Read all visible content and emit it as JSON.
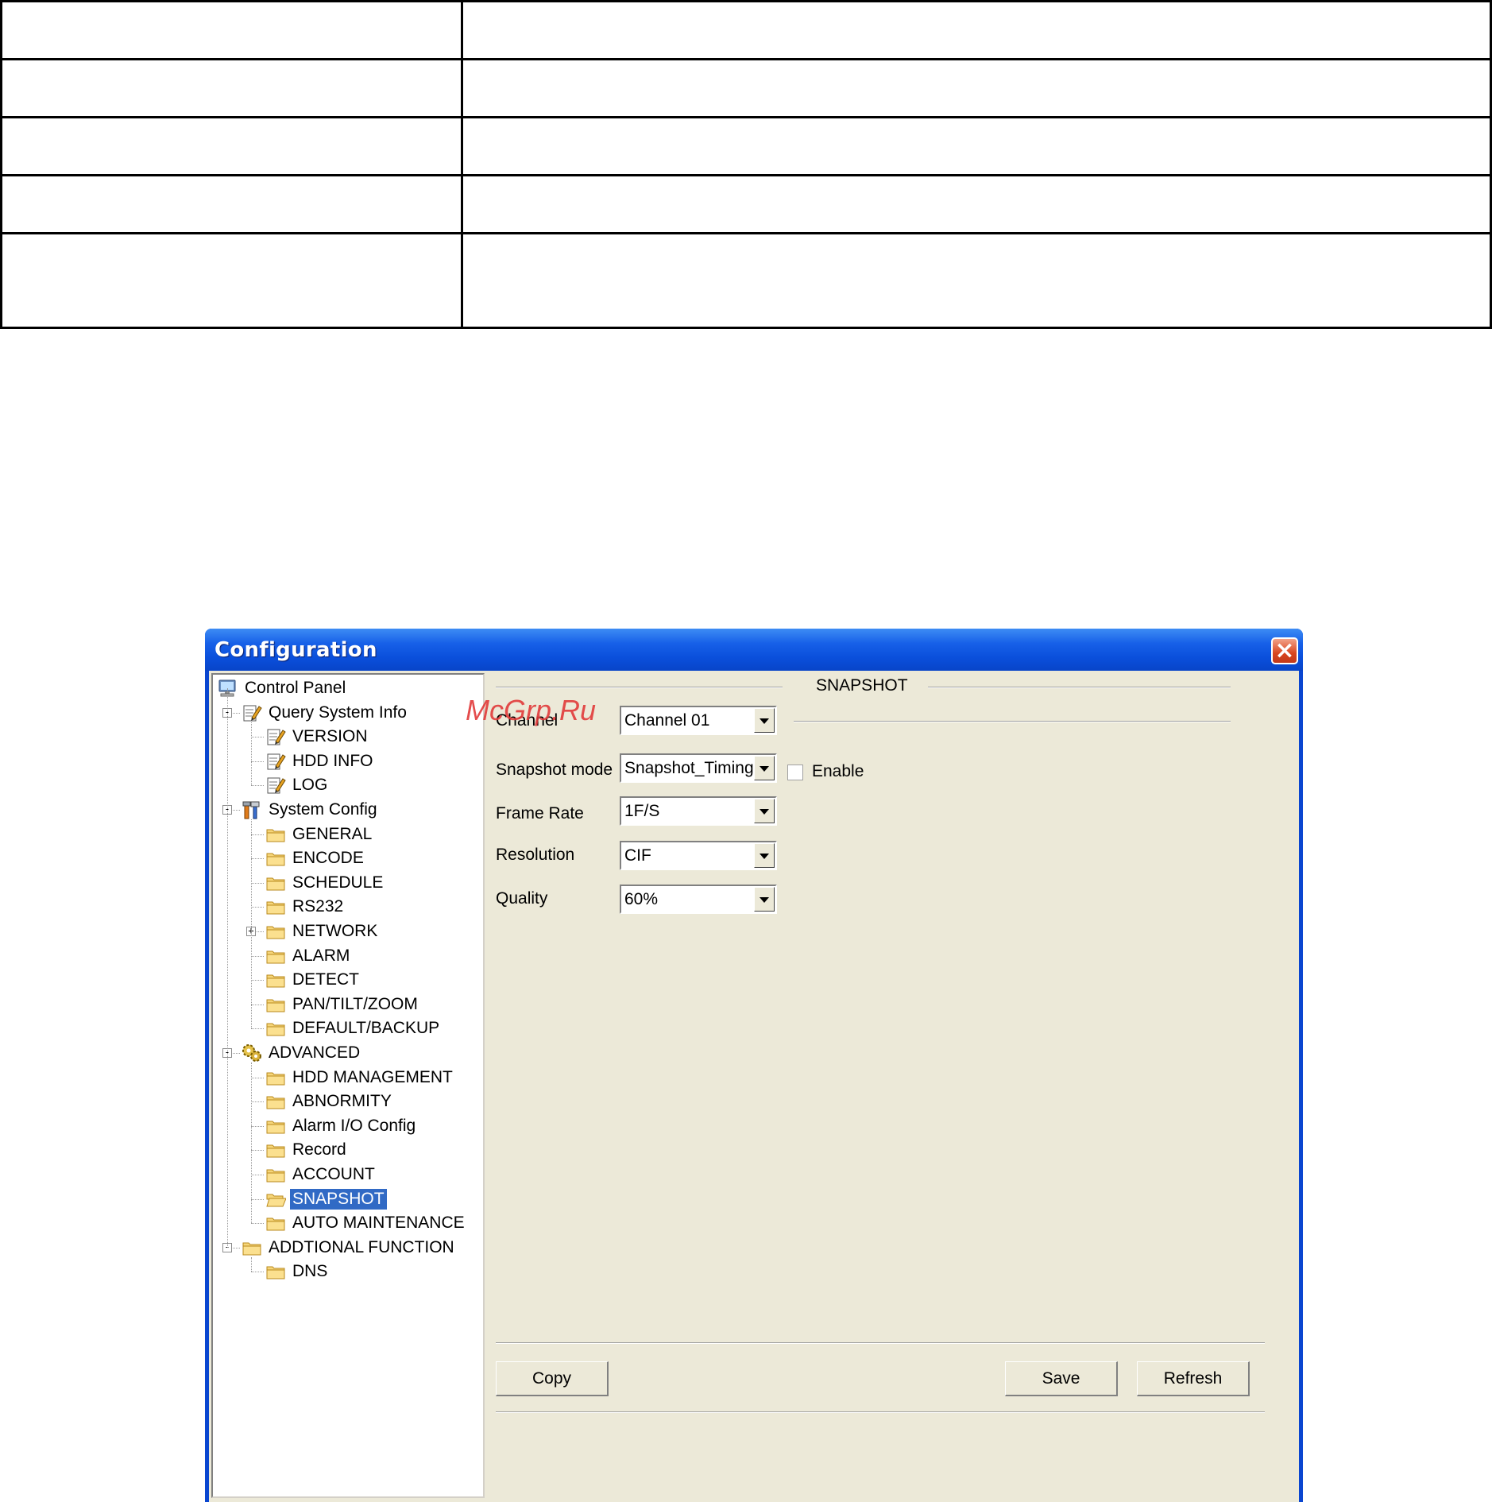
{
  "window": {
    "title": "Configuration"
  },
  "tree": [
    {
      "label": "Control Panel",
      "icon": "computer-icon",
      "level": 0,
      "selected": false
    },
    {
      "label": "Query System Info",
      "icon": "notepad-icon",
      "level": 1,
      "expander": "-",
      "selected": false
    },
    {
      "label": "VERSION",
      "icon": "notepad-icon",
      "level": 2,
      "selected": false
    },
    {
      "label": "HDD INFO",
      "icon": "notepad-icon",
      "level": 2,
      "selected": false
    },
    {
      "label": "LOG",
      "icon": "notepad-icon",
      "level": 2,
      "selected": false
    },
    {
      "label": "System Config",
      "icon": "tools-icon",
      "level": 1,
      "expander": "-",
      "selected": false
    },
    {
      "label": "GENERAL",
      "icon": "folder-icon",
      "level": 2,
      "selected": false
    },
    {
      "label": "ENCODE",
      "icon": "folder-icon",
      "level": 2,
      "selected": false
    },
    {
      "label": "SCHEDULE",
      "icon": "folder-icon",
      "level": 2,
      "selected": false
    },
    {
      "label": "RS232",
      "icon": "folder-icon",
      "level": 2,
      "selected": false
    },
    {
      "label": "NETWORK",
      "icon": "folder-icon",
      "level": 2,
      "expander": "+",
      "selected": false
    },
    {
      "label": "ALARM",
      "icon": "folder-icon",
      "level": 2,
      "selected": false
    },
    {
      "label": "DETECT",
      "icon": "folder-icon",
      "level": 2,
      "selected": false
    },
    {
      "label": "PAN/TILT/ZOOM",
      "icon": "folder-icon",
      "level": 2,
      "selected": false
    },
    {
      "label": "DEFAULT/BACKUP",
      "icon": "folder-icon",
      "level": 2,
      "selected": false
    },
    {
      "label": "ADVANCED",
      "icon": "gears-icon",
      "level": 1,
      "expander": "-",
      "selected": false
    },
    {
      "label": "HDD MANAGEMENT",
      "icon": "folder-icon",
      "level": 2,
      "selected": false
    },
    {
      "label": "ABNORMITY",
      "icon": "folder-icon",
      "level": 2,
      "selected": false
    },
    {
      "label": "Alarm I/O Config",
      "icon": "folder-icon",
      "level": 2,
      "selected": false
    },
    {
      "label": "Record",
      "icon": "folder-icon",
      "level": 2,
      "selected": false
    },
    {
      "label": "ACCOUNT",
      "icon": "folder-icon",
      "level": 2,
      "selected": false
    },
    {
      "label": "SNAPSHOT",
      "icon": "folder-open-icon",
      "level": 2,
      "selected": true
    },
    {
      "label": "AUTO MAINTENANCE",
      "icon": "folder-icon",
      "level": 2,
      "selected": false
    },
    {
      "label": "ADDTIONAL FUNCTION",
      "icon": "folder-icon",
      "level": 1,
      "expander": "-",
      "selected": false
    },
    {
      "label": "DNS",
      "icon": "folder-icon",
      "level": 2,
      "selected": false
    }
  ],
  "panel": {
    "heading": "SNAPSHOT",
    "channel": {
      "label": "Channel",
      "value": "Channel 01"
    },
    "snapshot_mode": {
      "label": "Snapshot mode",
      "value": "Snapshot_Timing",
      "enable_label": "Enable",
      "enable_checked": false
    },
    "frame_rate": {
      "label": "Frame Rate",
      "value": "1F/S"
    },
    "resolution": {
      "label": "Resolution",
      "value": "CIF"
    },
    "quality": {
      "label": "Quality",
      "value": "60%"
    },
    "buttons": {
      "copy": "Copy",
      "save": "Save",
      "refresh": "Refresh"
    }
  },
  "watermark": "McGrp.Ru",
  "colors": {
    "title_bar": "#0a4fdb",
    "selection": "#316ac5",
    "dialog_bg": "#ece9d8",
    "watermark": "#e23a3a"
  }
}
